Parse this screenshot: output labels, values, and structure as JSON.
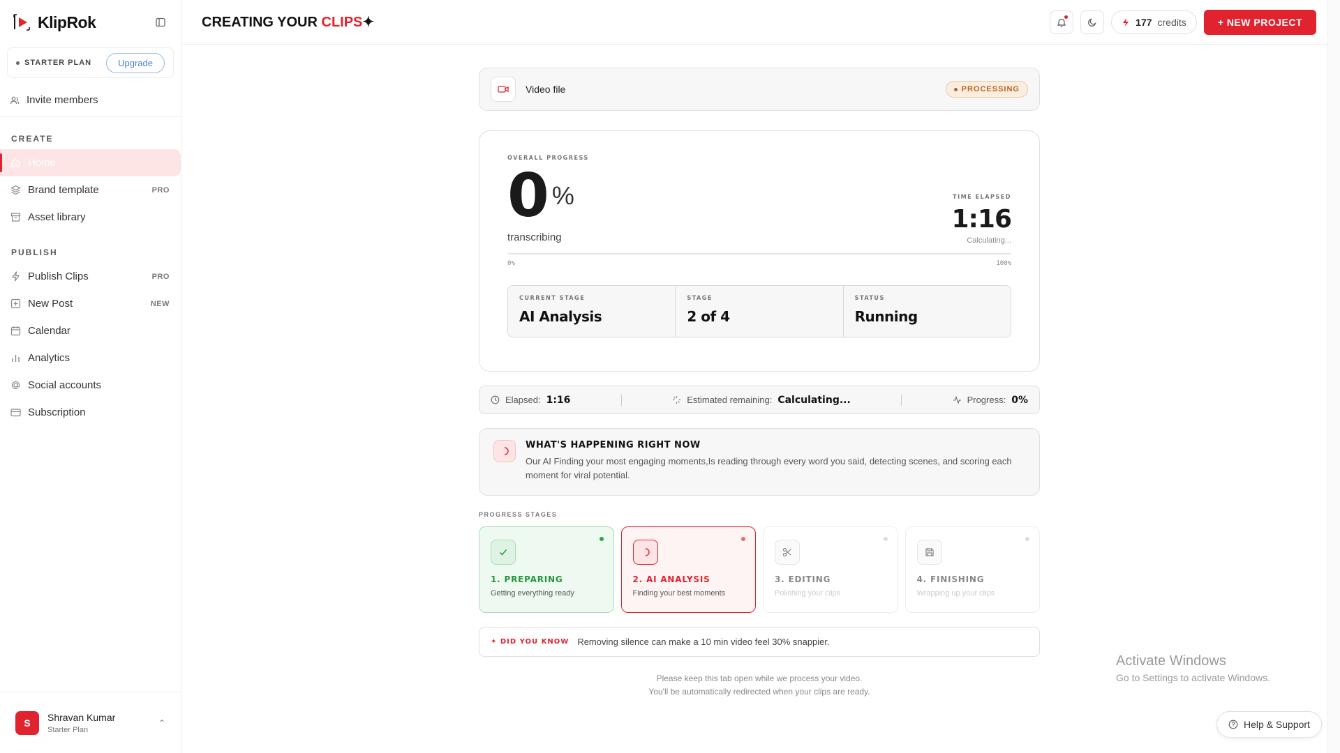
{
  "app": {
    "name": "KlipRok"
  },
  "sidebar": {
    "plan_label": "STARTER PLAN",
    "upgrade_label": "Upgrade",
    "invite_label": "Invite members",
    "create_title": "CREATE",
    "publish_title": "PUBLISH",
    "create_items": [
      {
        "label": "Home",
        "badge": "",
        "active": true
      },
      {
        "label": "Brand template",
        "badge": "PRO"
      },
      {
        "label": "Asset library",
        "badge": ""
      }
    ],
    "publish_items": [
      {
        "label": "Publish Clips",
        "badge": "PRO"
      },
      {
        "label": "New Post",
        "badge": "NEW"
      },
      {
        "label": "Calendar",
        "badge": ""
      },
      {
        "label": "Analytics",
        "badge": ""
      },
      {
        "label": "Social accounts",
        "badge": ""
      },
      {
        "label": "Subscription",
        "badge": ""
      }
    ],
    "user": {
      "initial": "S",
      "name": "Shravan Kumar",
      "plan": "Starter Plan"
    }
  },
  "header": {
    "title_prefix": "CREATING YOUR",
    "title_accent": "CLIPS",
    "title_suffix": "✦",
    "credits_value": "177",
    "credits_label": "credits",
    "new_project_label": "+ NEW PROJECT"
  },
  "file": {
    "name": "Video file",
    "status": "PROCESSING"
  },
  "progress": {
    "overall_label": "OVERALL PROGRESS",
    "percent": "0",
    "percent_sign": "%",
    "phase": "transcribing",
    "time_elapsed_label": "TIME ELAPSED",
    "time_elapsed": "1:16",
    "calculating": "Calculating...",
    "track_min": "0%",
    "track_max": "100%",
    "fill_fraction": 0,
    "current_stage_label": "CURRENT STAGE",
    "current_stage": "AI Analysis",
    "stage_label": "STAGE",
    "stage_value": "2 of 4",
    "status_label": "STATUS",
    "status_value": "Running"
  },
  "stats": {
    "elapsed_label": "Elapsed:",
    "elapsed_value": "1:16",
    "remaining_label": "Estimated remaining:",
    "remaining_value": "Calculating...",
    "progress_label": "Progress:",
    "progress_value": "0%"
  },
  "happening": {
    "title": "WHAT'S HAPPENING RIGHT NOW",
    "text": "Our AI Finding your most engaging moments,Is reading through every word you said, detecting scenes, and scoring each moment for viral potential."
  },
  "stages": {
    "label": "PROGRESS STAGES",
    "items": [
      {
        "name": "1. PREPARING",
        "desc": "Getting everything ready",
        "state": "done",
        "icon": "check-icon"
      },
      {
        "name": "2. AI ANALYSIS",
        "desc": "Finding your best moments",
        "state": "current",
        "icon": "spinner-icon"
      },
      {
        "name": "3. EDITING",
        "desc": "Polishing your clips",
        "state": "pending",
        "icon": "scissors-icon"
      },
      {
        "name": "4. FINISHING",
        "desc": "Wrapping up your clips",
        "state": "pending",
        "icon": "save-icon"
      }
    ]
  },
  "tip": {
    "tag": "✦ DID YOU KNOW",
    "text": "Removing silence can make a 10 min video feel 30% snappier."
  },
  "footnote": {
    "line1": "Please keep this tab open while we process your video.",
    "line2": "You'll be automatically redirected when your clips are ready."
  },
  "watermark": {
    "line1": "Activate Windows",
    "line2": "Go to Settings to activate Windows."
  },
  "help": {
    "label": "Help & Support"
  },
  "colors": {
    "accent": "#e0232e",
    "success": "#23963d",
    "warning": "#b5651d"
  }
}
